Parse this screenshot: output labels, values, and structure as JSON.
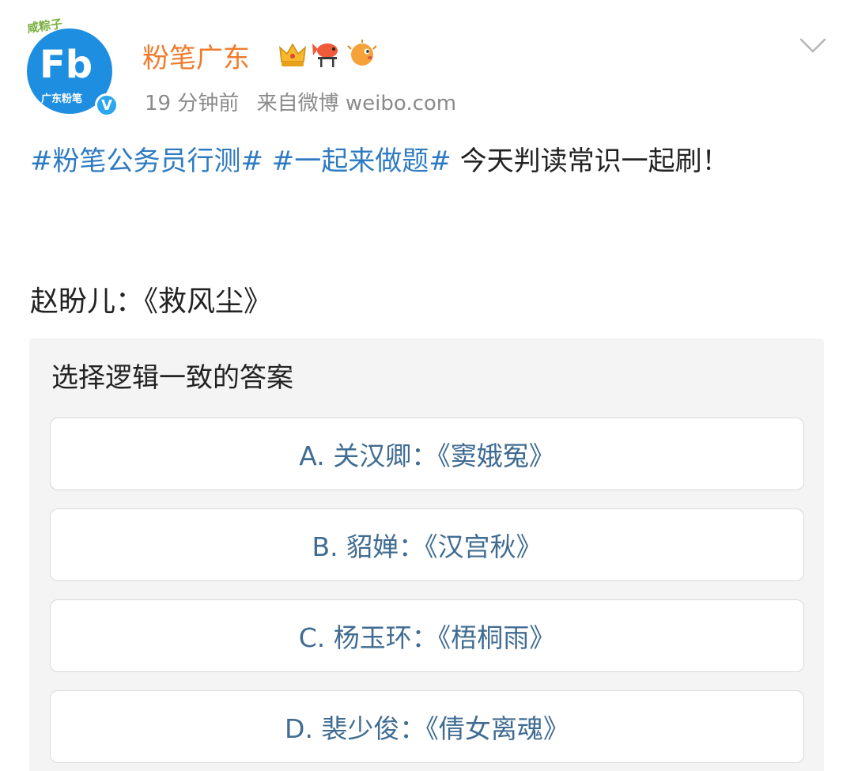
{
  "header": {
    "username": "粉笔广东",
    "avatar_caption": "广东粉笔",
    "avatar_top_badge": "咸粽子",
    "avatar_logo_text": "Fb",
    "verified_symbol": "V",
    "badges": [
      "crown-icon",
      "koi-fish-icon",
      "pufferfish-icon"
    ],
    "time": "19 分钟前",
    "source": "来自微博 weibo.com"
  },
  "post": {
    "hashtag1": "#粉笔公务员行测#",
    "hashtag2": "#一起来做题#",
    "text": " 今天判读常识一起刷！",
    "subtitle": "赵盼儿：《救风尘》"
  },
  "poll": {
    "title": "选择逻辑一致的答案",
    "options": [
      {
        "label": "A. 关汉卿：《窦娥冤》"
      },
      {
        "label": "B. 貂婵：《汉宫秋》"
      },
      {
        "label": "C. 杨玉环：《梧桐雨》"
      },
      {
        "label": "D. 裴少俊：《倩女离魂》"
      }
    ]
  },
  "colors": {
    "username": "#f07b2c",
    "hashtag": "#2f7bc2",
    "option_text": "#416c92",
    "meta": "#8a8a8a",
    "avatar": "#1e8fe0"
  }
}
